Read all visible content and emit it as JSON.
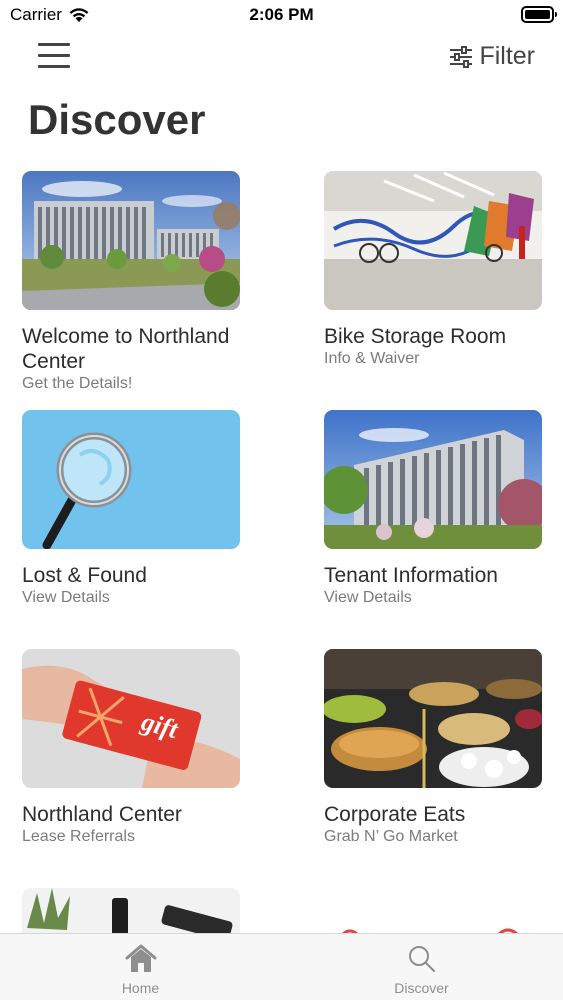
{
  "status_bar": {
    "carrier": "Carrier",
    "time": "2:06 PM"
  },
  "nav": {
    "filter_label": "Filter"
  },
  "page": {
    "title": "Discover"
  },
  "cards": [
    {
      "title": "Welcome to Northland Center",
      "subtitle": "Get the Details!"
    },
    {
      "title": "Bike Storage Room",
      "subtitle": "Info & Waiver"
    },
    {
      "title": "Lost & Found",
      "subtitle": "View Details"
    },
    {
      "title": "Tenant Information",
      "subtitle": "View Details"
    },
    {
      "title": "Northland Center",
      "subtitle": "Lease Referrals",
      "image_text": "gift"
    },
    {
      "title": "Corporate Eats",
      "subtitle": "Grab N’ Go Market"
    }
  ],
  "tab_bar": {
    "tabs": [
      {
        "label": "Home",
        "icon": "home-icon"
      },
      {
        "label": "Discover",
        "icon": "search-icon"
      }
    ]
  }
}
